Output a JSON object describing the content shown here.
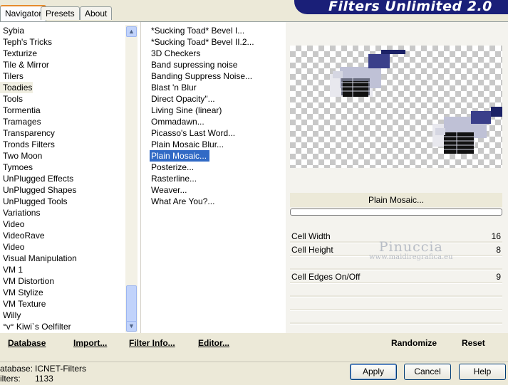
{
  "tabs": [
    "Navigator",
    "Presets",
    "About"
  ],
  "banner_title": "Filters Unlimited 2.0",
  "categories": [
    {
      "label": "Sybia"
    },
    {
      "label": "Teph's Tricks"
    },
    {
      "label": "Texturize"
    },
    {
      "label": "Tile & Mirror"
    },
    {
      "label": "Tilers"
    },
    {
      "label": "Toadies",
      "selected": true
    },
    {
      "label": "Tools"
    },
    {
      "label": "Tormentia"
    },
    {
      "label": "Tramages"
    },
    {
      "label": "Transparency"
    },
    {
      "label": "Tronds Filters"
    },
    {
      "label": "Two Moon"
    },
    {
      "label": "Tymoes"
    },
    {
      "label": "UnPlugged Effects"
    },
    {
      "label": "UnPlugged Shapes"
    },
    {
      "label": "UnPlugged Tools"
    },
    {
      "label": "Variations"
    },
    {
      "label": "Video"
    },
    {
      "label": "VideoRave"
    },
    {
      "label": "Video"
    },
    {
      "label": "Visual Manipulation"
    },
    {
      "label": "VM 1"
    },
    {
      "label": "VM Distortion"
    },
    {
      "label": "VM Stylize"
    },
    {
      "label": "VM Texture"
    },
    {
      "label": "Willy"
    },
    {
      "label": "°v° Kiwi`s Oelfilter"
    }
  ],
  "filters": [
    {
      "label": "*Sucking Toad*  Bevel I..."
    },
    {
      "label": "*Sucking Toad*  Bevel II.2..."
    },
    {
      "label": "3D Checkers"
    },
    {
      "label": "Band supressing noise"
    },
    {
      "label": "Banding Suppress Noise..."
    },
    {
      "label": "Blast 'n Blur"
    },
    {
      "label": "Direct Opacity\"..."
    },
    {
      "label": "Living Sine (linear)"
    },
    {
      "label": "Ommadawn..."
    },
    {
      "label": "Picasso's Last Word..."
    },
    {
      "label": "Plain Mosaic Blur..."
    },
    {
      "label": "Plain Mosaic...",
      "selected": true
    },
    {
      "label": "Posterize..."
    },
    {
      "label": "Rasterline..."
    },
    {
      "label": "Weaver..."
    },
    {
      "label": "What Are You?..."
    }
  ],
  "selected_filter": "Plain Mosaic...",
  "params": [
    {
      "label": "Cell Width",
      "value": "16"
    },
    {
      "label": "Cell Height",
      "value": "8"
    },
    {
      "label": "",
      "value": ""
    },
    {
      "label": "Cell Edges On/Off",
      "value": "9"
    },
    {
      "label": "",
      "value": ""
    },
    {
      "label": "",
      "value": ""
    },
    {
      "label": "",
      "value": ""
    },
    {
      "label": "",
      "value": ""
    }
  ],
  "watermark": {
    "line1": "Pinuccia",
    "line2": "www.maidiregrafica.eu"
  },
  "toolbar": {
    "database": "Database",
    "import": "Import...",
    "filter_info": "Filter Info...",
    "editor": "Editor...",
    "randomize": "Randomize",
    "reset": "Reset"
  },
  "status": {
    "database_label": "atabase:",
    "database_value": "ICNET-Filters",
    "filters_label": "ilters:",
    "filters_value": "1133"
  },
  "buttons": {
    "apply": "Apply",
    "cancel": "Cancel",
    "help": "Help"
  },
  "colors": {
    "selection": "#316ac5",
    "banner": "#1a1f78",
    "mosaic": "#1c2266"
  }
}
